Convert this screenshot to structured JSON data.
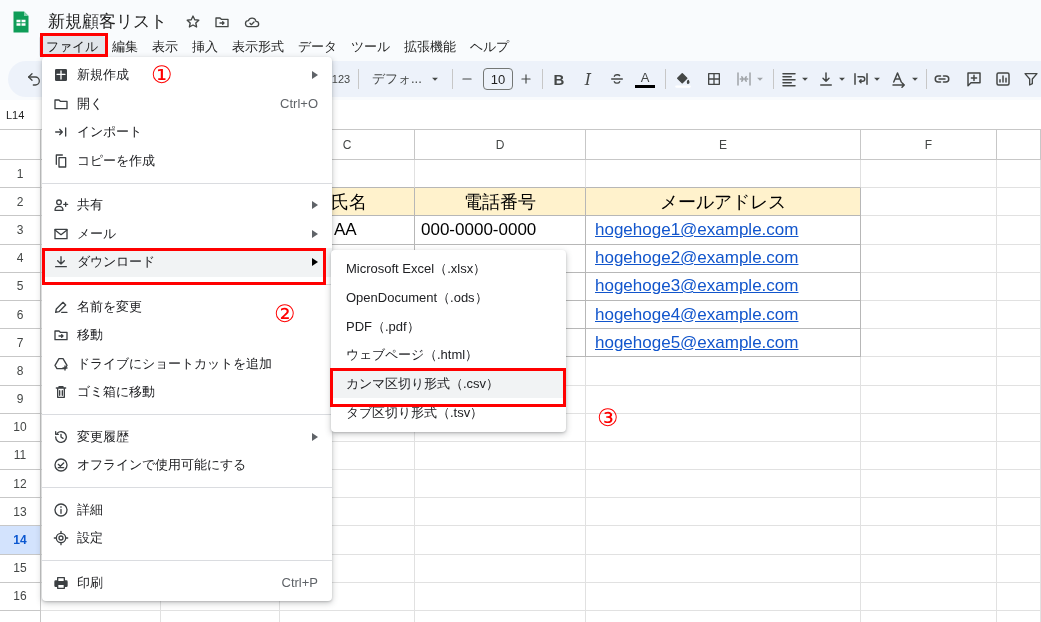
{
  "document": {
    "title": "新規顧客リスト"
  },
  "menu_bar": [
    {
      "label": "ファイル",
      "selected": true
    },
    {
      "label": "編集",
      "selected": false
    },
    {
      "label": "表示",
      "selected": false
    },
    {
      "label": "挿入",
      "selected": false
    },
    {
      "label": "表示形式",
      "selected": false
    },
    {
      "label": "データ",
      "selected": false
    },
    {
      "label": "ツール",
      "selected": false
    },
    {
      "label": "拡張機能",
      "selected": false
    },
    {
      "label": "ヘルプ",
      "selected": false
    }
  ],
  "toolbar": {
    "number_format": "123",
    "font": "デフォ...",
    "font_size": "10",
    "bold": "B",
    "italic": "I",
    "text_color": "A",
    "merge_disabled": true
  },
  "name_box": "L14",
  "columns": [
    {
      "label": "C"
    },
    {
      "label": "D"
    },
    {
      "label": "E"
    },
    {
      "label": "F"
    }
  ],
  "rows": [
    {
      "label": "1",
      "selected": false
    },
    {
      "label": "2",
      "selected": false
    },
    {
      "label": "3",
      "selected": false
    },
    {
      "label": "4",
      "selected": false
    },
    {
      "label": "5",
      "selected": false
    },
    {
      "label": "6",
      "selected": false
    },
    {
      "label": "7",
      "selected": false
    },
    {
      "label": "8",
      "selected": false
    },
    {
      "label": "9",
      "selected": false
    },
    {
      "label": "10",
      "selected": false
    },
    {
      "label": "11",
      "selected": false
    },
    {
      "label": "12",
      "selected": false
    },
    {
      "label": "13",
      "selected": false
    },
    {
      "label": "14",
      "selected": true
    },
    {
      "label": "15",
      "selected": false
    },
    {
      "label": "16",
      "selected": false
    }
  ],
  "table": {
    "header": [
      "氏名",
      "電話番号",
      "メールアドレス"
    ],
    "rows": [
      {
        "name": "AA",
        "phone": "000-0000-0000",
        "email": "hogehoge1@example.com"
      },
      {
        "email": "hogehoge2@example.com"
      },
      {
        "email": "hogehoge3@example.com"
      },
      {
        "email": "hogehoge4@example.com"
      },
      {
        "email": "hogehoge5@example.com"
      }
    ]
  },
  "file_menu": {
    "groups": [
      {
        "items": [
          {
            "label": "新規作成",
            "has_submenu": true,
            "selected": false
          },
          {
            "label": "開く",
            "shortcut": "Ctrl+O",
            "has_submenu": false,
            "selected": false
          },
          {
            "label": "インポート",
            "has_submenu": false,
            "selected": false
          },
          {
            "label": "コピーを作成",
            "has_submenu": false,
            "selected": false
          }
        ]
      },
      {
        "items": [
          {
            "label": "共有",
            "has_submenu": true,
            "selected": false
          },
          {
            "label": "メール",
            "has_submenu": true,
            "selected": false
          },
          {
            "label": "ダウンロード",
            "has_submenu": true,
            "selected": true
          }
        ]
      },
      {
        "items": [
          {
            "label": "名前を変更",
            "has_submenu": false,
            "selected": false
          },
          {
            "label": "移動",
            "has_submenu": false,
            "selected": false
          },
          {
            "label": "ドライブにショートカットを追加",
            "has_submenu": false,
            "selected": false
          },
          {
            "label": "ゴミ箱に移動",
            "has_submenu": false,
            "selected": false
          }
        ]
      },
      {
        "items": [
          {
            "label": "変更履歴",
            "has_submenu": true,
            "selected": false
          },
          {
            "label": "オフラインで使用可能にする",
            "has_submenu": false,
            "selected": false
          }
        ]
      },
      {
        "items": [
          {
            "label": "詳細",
            "has_submenu": false,
            "selected": false
          },
          {
            "label": "設定",
            "has_submenu": false,
            "selected": false
          }
        ]
      },
      {
        "items": [
          {
            "label": "印刷",
            "shortcut": "Ctrl+P",
            "has_submenu": false,
            "selected": false
          }
        ]
      }
    ]
  },
  "download_menu": {
    "items": [
      {
        "label": "Microsoft Excel（.xlsx）",
        "selected": false
      },
      {
        "label": "OpenDocument（.ods）",
        "selected": false
      },
      {
        "label": "PDF（.pdf）",
        "selected": false
      },
      {
        "label": "ウェブページ（.html）",
        "selected": false
      },
      {
        "label": "カンマ区切り形式（.csv）",
        "selected": true
      },
      {
        "label": "タブ区切り形式（.tsv）",
        "selected": false
      }
    ]
  },
  "annotations": {
    "steps": [
      "①",
      "②",
      "③"
    ]
  }
}
